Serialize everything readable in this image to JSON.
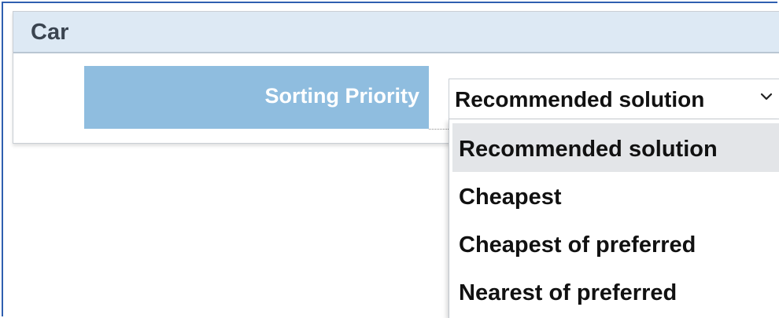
{
  "panel": {
    "title": "Car"
  },
  "sorting": {
    "label": "Sorting Priority",
    "selected_value": "Recommended solution",
    "options": [
      {
        "label": "Recommended solution",
        "selected": true
      },
      {
        "label": "Cheapest",
        "selected": false
      },
      {
        "label": "Cheapest of preferred",
        "selected": false
      },
      {
        "label": "Nearest of preferred",
        "selected": false
      }
    ]
  },
  "icons": {
    "dropdown_chevron": "chevron-down-icon"
  },
  "colors": {
    "border_accent": "#2f5fb0",
    "header_bg": "#dde9f4",
    "label_bg": "#8fbddf",
    "selected_option_bg": "#e3e5e8"
  }
}
